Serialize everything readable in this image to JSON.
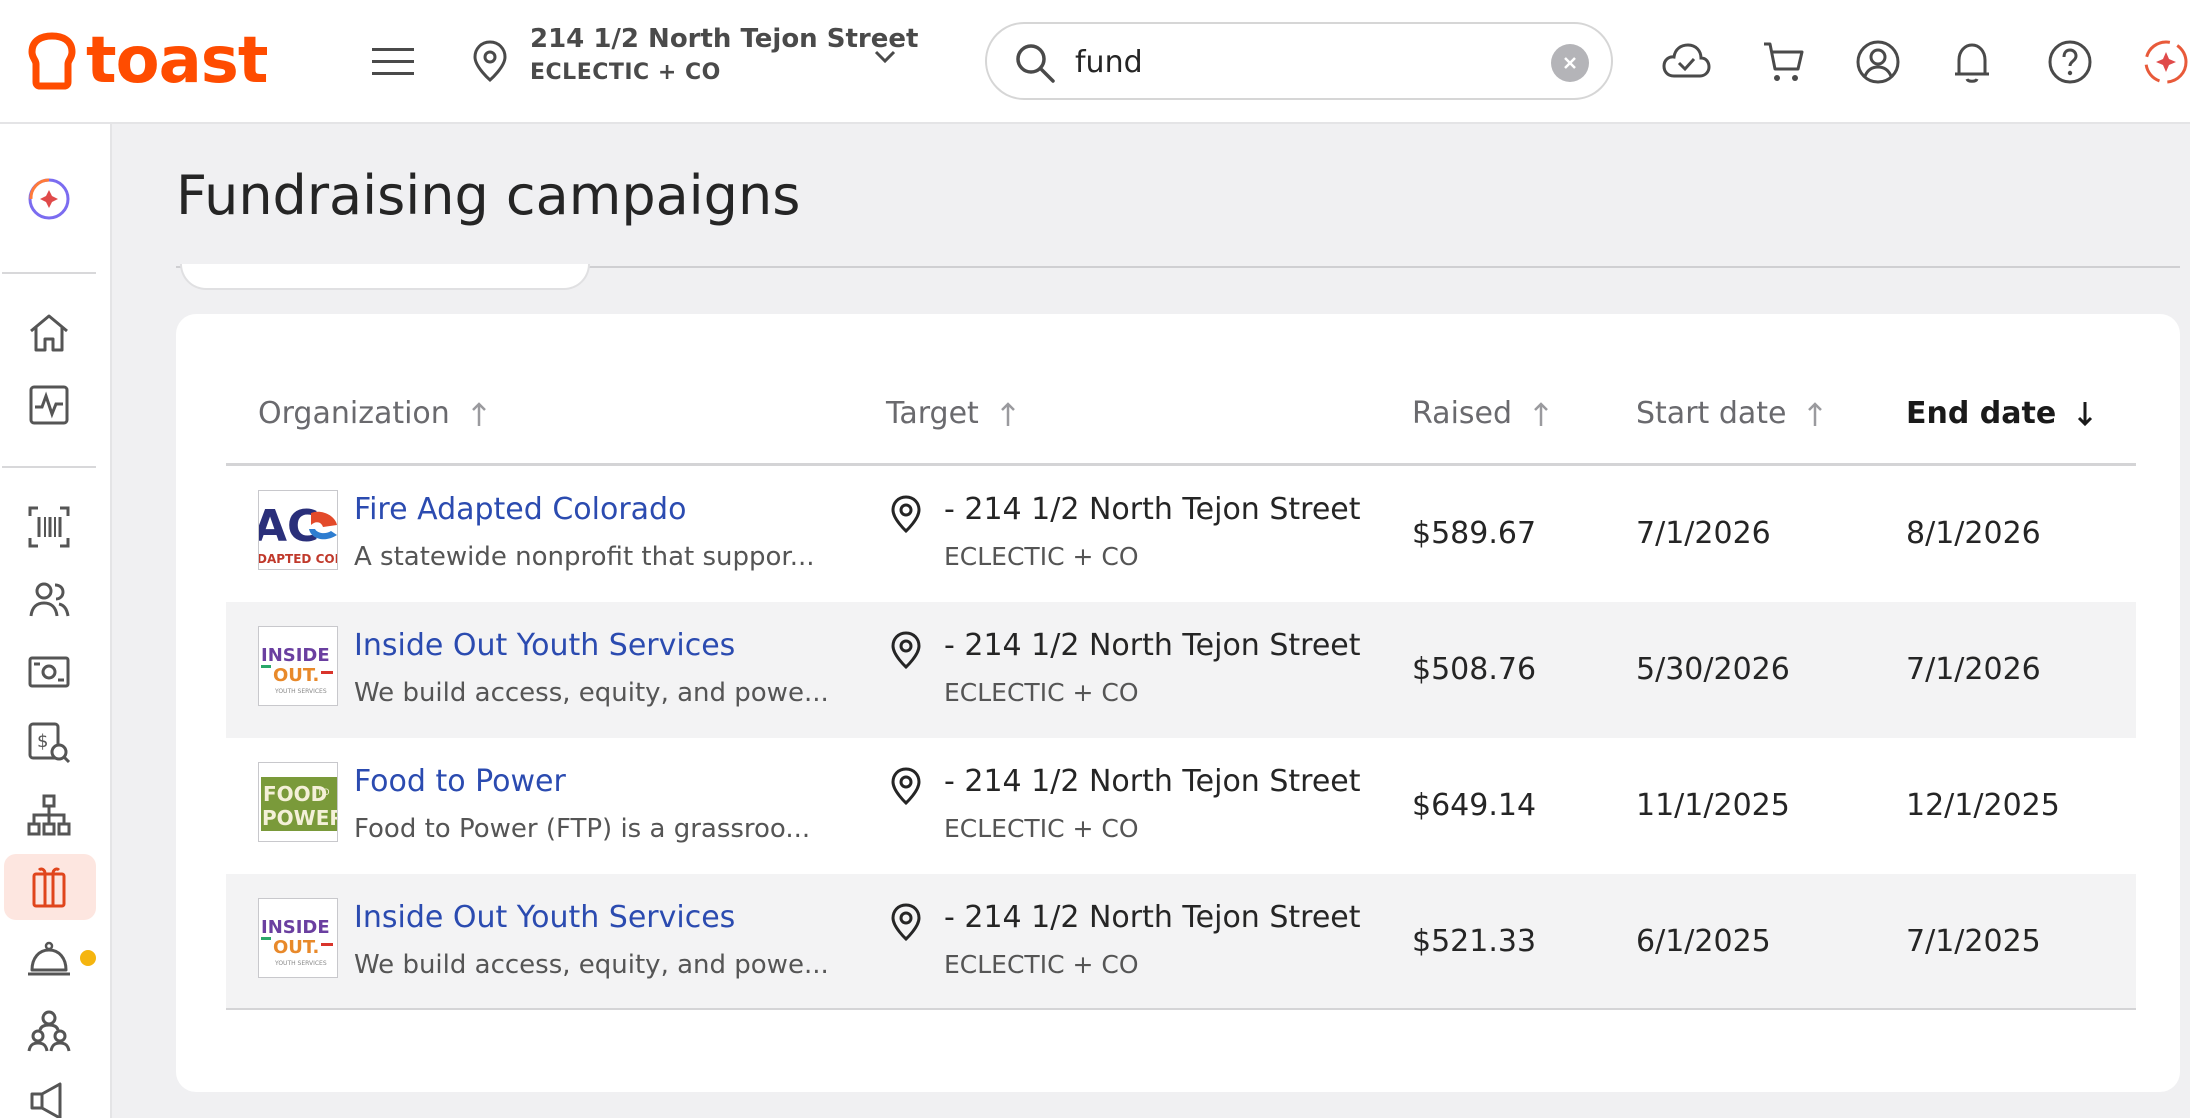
{
  "brand": {
    "name": "toast",
    "accent": "#ff4c00"
  },
  "header": {
    "location_line1": "214 1/2 North Tejon Street",
    "location_line2": "ECLECTIC + CO",
    "search_value": "fund",
    "icons": [
      "sync-cloud-icon",
      "cart-icon",
      "account-icon",
      "notifications-icon",
      "help-icon",
      "ai-assistant-icon"
    ]
  },
  "sidebar": {
    "icons": [
      "ai-assistant-icon",
      "home-icon",
      "reports-icon",
      "menu-scan-icon",
      "guests-icon",
      "payments-icon",
      "payroll-icon",
      "org-chart-icon",
      "gift-card-icon",
      "service-bell-icon",
      "team-icon",
      "marketing-icon"
    ],
    "active": "gift-card-icon"
  },
  "page": {
    "title": "Fundraising campaigns"
  },
  "table": {
    "columns": {
      "organization": "Organization",
      "target": "Target",
      "raised": "Raised",
      "start_date": "Start date",
      "end_date": "End date"
    },
    "sorted_by": "End date",
    "rows": [
      {
        "name": "Fire Adapted Colorado",
        "description": "A statewide nonprofit that suppor...",
        "target_line1": "- 214 1/2 North Tejon Street",
        "target_line2": "ECLECTIC + CO",
        "raised": "$589.67",
        "start": "7/1/2026",
        "end": "8/1/2026",
        "logo_text": [
          "AC",
          "DAPTED COL"
        ]
      },
      {
        "name": "Inside Out Youth Services",
        "description": "We build access, equity, and powe...",
        "target_line1": "- 214 1/2 North Tejon Street",
        "target_line2": "ECLECTIC + CO",
        "raised": "$508.76",
        "start": "5/30/2026",
        "end": "7/1/2026",
        "logo_text": [
          "INSIDE",
          "OUT.",
          "YOUTH SERVICES"
        ]
      },
      {
        "name": "Food to Power",
        "description": "Food to Power (FTP) is a grassroo...",
        "target_line1": "- 214 1/2 North Tejon Street",
        "target_line2": "ECLECTIC + CO",
        "raised": "$649.14",
        "start": "11/1/2025",
        "end": "12/1/2025",
        "logo_text": [
          "FOOD",
          "TO",
          "POWER"
        ]
      },
      {
        "name": "Inside Out Youth Services",
        "description": "We build access, equity, and powe...",
        "target_line1": "- 214 1/2 North Tejon Street",
        "target_line2": "ECLECTIC + CO",
        "raised": "$521.33",
        "start": "6/1/2025",
        "end": "7/1/2025",
        "logo_text": [
          "INSIDE",
          "OUT.",
          "YOUTH SERVICES"
        ]
      }
    ]
  }
}
